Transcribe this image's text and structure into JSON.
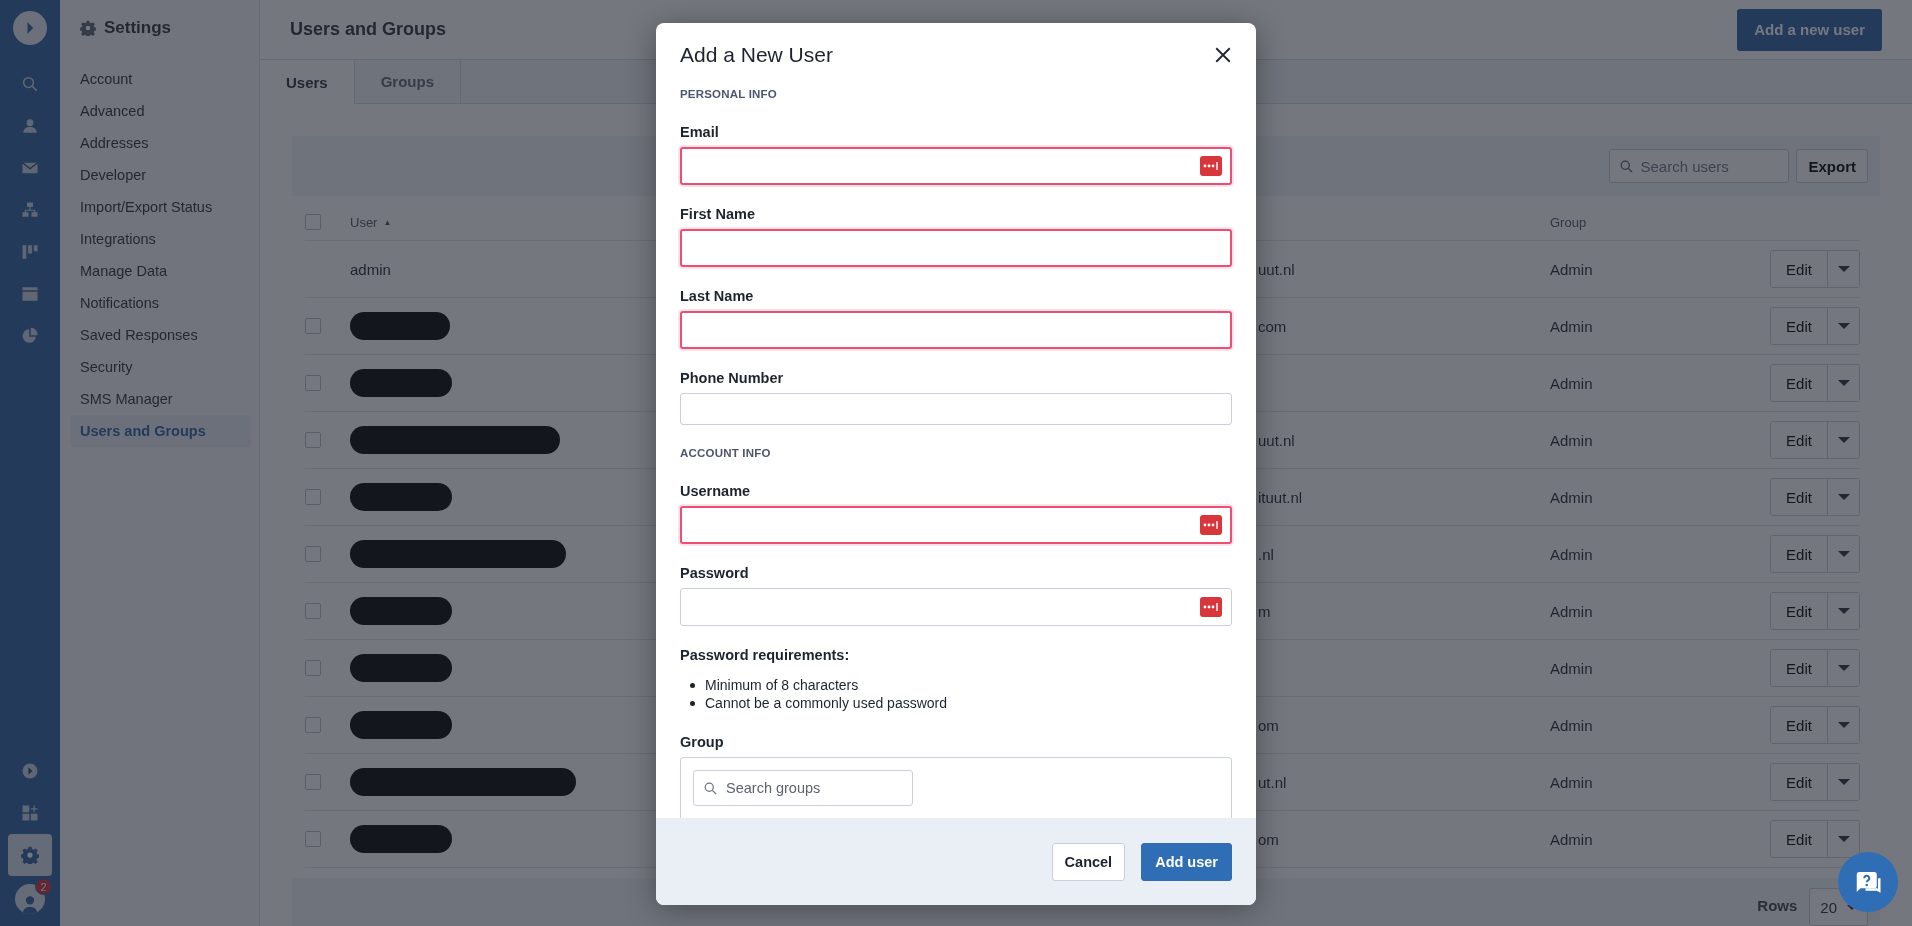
{
  "rail": {
    "items": [
      {
        "selected": false
      },
      {
        "selected": false
      },
      {
        "selected": false
      },
      {
        "selected": false
      },
      {
        "selected": false
      },
      {
        "selected": false
      },
      {
        "selected": false
      }
    ],
    "tools": [
      {
        "selected": false
      },
      {
        "selected": false
      },
      {
        "selected": true
      }
    ],
    "badge": "2"
  },
  "settings": {
    "title": "Settings",
    "items": [
      {
        "label": "Account",
        "selected": false
      },
      {
        "label": "Advanced",
        "selected": false
      },
      {
        "label": "Addresses",
        "selected": false
      },
      {
        "label": "Developer",
        "selected": false
      },
      {
        "label": "Import/Export Status",
        "selected": false
      },
      {
        "label": "Integrations",
        "selected": false
      },
      {
        "label": "Manage Data",
        "selected": false
      },
      {
        "label": "Notifications",
        "selected": false
      },
      {
        "label": "Saved Responses",
        "selected": false
      },
      {
        "label": "Security",
        "selected": false
      },
      {
        "label": "SMS Manager",
        "selected": false
      },
      {
        "label": "Users and Groups",
        "selected": true
      }
    ]
  },
  "page": {
    "title": "Users and Groups",
    "add_button": "Add a new user",
    "tabs": [
      {
        "label": "Users",
        "selected": true
      },
      {
        "label": "Groups",
        "selected": false
      }
    ],
    "search": {
      "placeholder": "Search users"
    },
    "export_button": "Export",
    "table": {
      "header_checked": false,
      "columns": [
        "User",
        "Group"
      ],
      "sort_icon": "▲",
      "rows": [
        {
          "user": "admin",
          "redacted": false,
          "email": "uut.nl",
          "group": "Admin",
          "action": "Edit"
        },
        {
          "redacted": true,
          "checked": false,
          "email": "com",
          "group": "Admin",
          "action": "Edit"
        },
        {
          "redacted": true,
          "checked": false,
          "group": "Admin",
          "action": "Edit"
        },
        {
          "redacted": true,
          "checked": false,
          "email": "uut.nl",
          "group": "Admin",
          "action": "Edit"
        },
        {
          "redacted": true,
          "checked": false,
          "email": "ituut.nl",
          "group": "Admin",
          "action": "Edit"
        },
        {
          "redacted": true,
          "checked": false,
          "email": ".nl",
          "group": "Admin",
          "action": "Edit"
        },
        {
          "redacted": true,
          "checked": false,
          "email": "m",
          "group": "Admin",
          "action": "Edit"
        },
        {
          "redacted": true,
          "checked": false,
          "group": "Admin",
          "action": "Edit"
        },
        {
          "redacted": true,
          "checked": false,
          "email": "om",
          "group": "Admin",
          "action": "Edit"
        },
        {
          "redacted": true,
          "checked": false,
          "email": "ut.nl",
          "group": "Admin",
          "action": "Edit"
        },
        {
          "redacted": true,
          "checked": false,
          "email": "om",
          "group": "Admin",
          "action": "Edit"
        }
      ]
    },
    "rows_label": "Rows",
    "rows_value": "20"
  },
  "modal": {
    "title": "Add a New User",
    "sections": [
      {
        "heading": "PERSONAL INFO",
        "fields": [
          {
            "label": "Email",
            "invalid": true,
            "autofill": true
          },
          {
            "label": "First Name",
            "invalid": true,
            "autofill": false
          },
          {
            "label": "Last Name",
            "invalid": true,
            "autofill": false
          },
          {
            "label": "Phone Number",
            "invalid": false,
            "autofill": false
          }
        ]
      },
      {
        "heading": "ACCOUNT INFO",
        "fields": [
          {
            "label": "Username",
            "invalid": true,
            "autofill": true
          },
          {
            "label": "Password",
            "invalid": false,
            "autofill": true
          }
        ]
      }
    ],
    "requirements_title": "Password requirements:",
    "requirements": [
      "Minimum of 8 characters",
      "Cannot be a commonly used password"
    ],
    "group_label": "Group",
    "group_search": {
      "placeholder": "Search groups"
    },
    "buttons": [
      {
        "label": "Cancel",
        "kind": "secondary"
      },
      {
        "label": "Add user",
        "kind": "primary"
      }
    ]
  }
}
